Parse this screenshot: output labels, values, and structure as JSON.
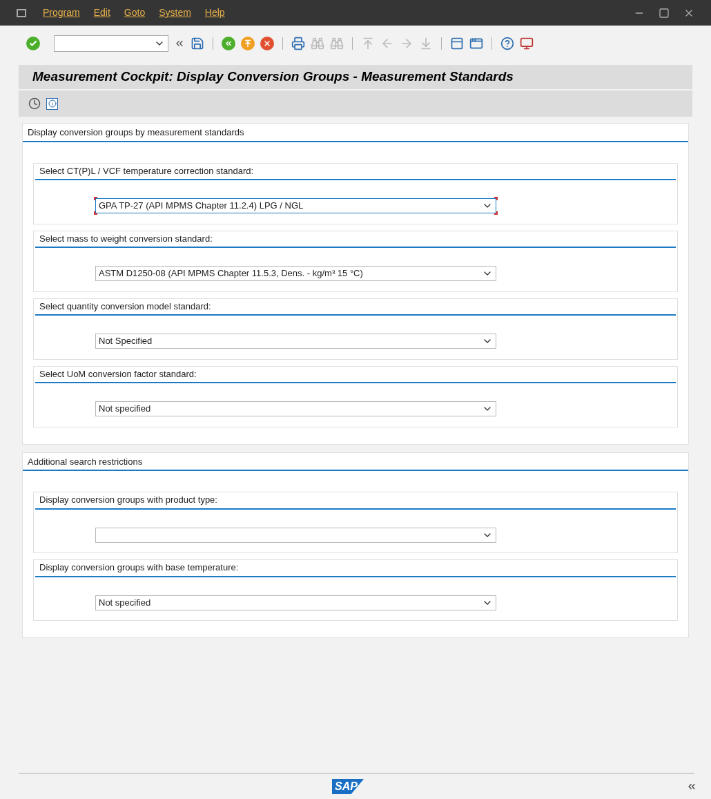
{
  "menu": [
    {
      "label": "Program"
    },
    {
      "label": "Edit"
    },
    {
      "label": "Goto"
    },
    {
      "label": "System"
    },
    {
      "label": "Help"
    }
  ],
  "title": "Measurement Cockpit: Display Conversion Groups - Measurement Standards",
  "sections": [
    {
      "heading": "Display conversion groups by measurement standards",
      "groups": [
        {
          "label": "Select CT(P)L / VCF temperature correction standard:",
          "value": "GPA TP-27 (API MPMS Chapter 11.2.4) LPG / NGL",
          "focused": true
        },
        {
          "label": "Select mass to weight conversion standard:",
          "value": "ASTM D1250-08 (API MPMS Chapter 11.5.3, Dens. - kg/m³ 15 °C)",
          "focused": false
        },
        {
          "label": "Select quantity conversion model standard:",
          "value": "Not Specified",
          "focused": false
        },
        {
          "label": "Select UoM conversion factor standard:",
          "value": "Not specified",
          "focused": false
        }
      ]
    },
    {
      "heading": "Additional search restrictions",
      "groups": [
        {
          "label": "Display conversion groups with product type:",
          "focused": false
        },
        {
          "label": "Display conversion groups with base temperature:",
          "value": "Not specified",
          "focused": false
        }
      ]
    }
  ],
  "logo": "SAP"
}
